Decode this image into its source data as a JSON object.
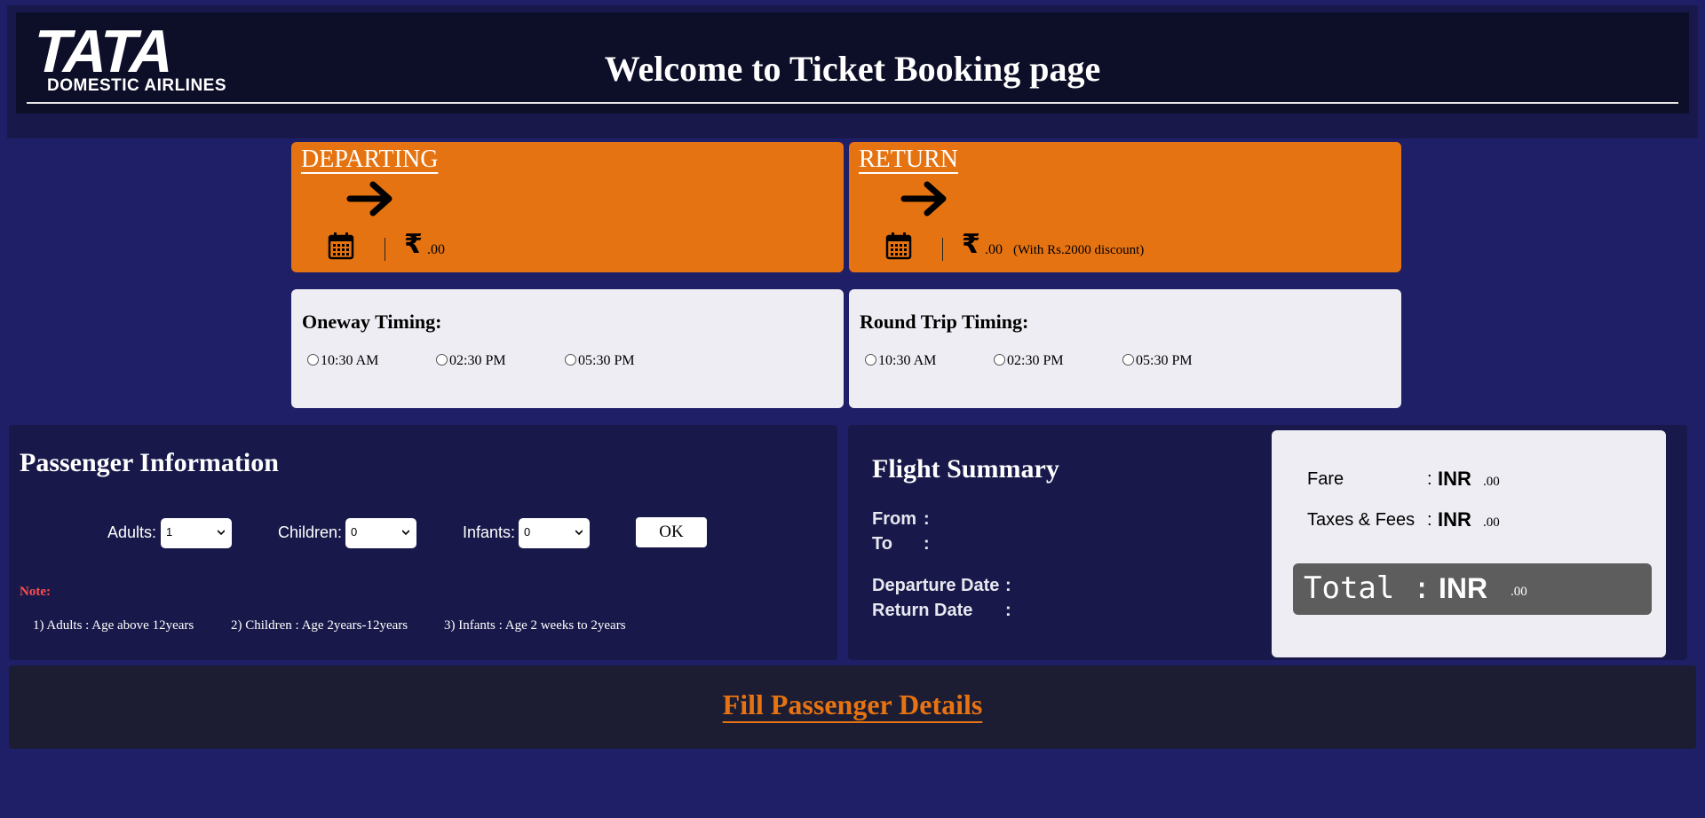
{
  "header": {
    "logo_text": "TATA",
    "logo_subtext": "DOMESTIC AIRLINES",
    "title": "Welcome to Ticket Booking page"
  },
  "departing": {
    "title": "DEPARTING",
    "currency_symbol": "₹",
    "amount": ".00"
  },
  "return_card": {
    "title": "RETURN",
    "currency_symbol": "₹",
    "amount": ".00",
    "discount_note": "(With Rs.2000 discount)"
  },
  "oneway": {
    "title": "Oneway Timing:",
    "options": [
      "10:30 AM",
      "02:30 PM",
      "05:30 PM"
    ]
  },
  "roundtrip": {
    "title": "Round Trip Timing:",
    "options": [
      "10:30 AM",
      "02:30 PM",
      "05:30 PM"
    ]
  },
  "passenger": {
    "title": "Passenger Information",
    "adults_label": "Adults:",
    "adults_value": "1",
    "children_label": "Children:",
    "children_value": "0",
    "infants_label": "Infants:",
    "infants_value": "0",
    "ok_label": "OK",
    "note_label": "Note:",
    "notes": [
      "1)  Adults : Age above 12years",
      "2)  Children : Age 2years-12years",
      "3)  Infants : Age 2 weeks to 2years"
    ]
  },
  "summary": {
    "title": "Flight Summary",
    "from_label": "From",
    "to_label": "To",
    "departure_label": "Departure Date",
    "return_label": "Return Date",
    "colon": ":"
  },
  "fare": {
    "fare_label": "Fare",
    "taxes_label": "Taxes & Fees",
    "colon": ":",
    "currency": "INR",
    "fare_amount": ".00",
    "taxes_amount": ".00",
    "total_label": "Total  :",
    "total_currency": "INR",
    "total_amount": ".00"
  },
  "cta": {
    "label": "Fill Passenger Details"
  },
  "colors": {
    "page_bg": "#1e1f66",
    "accent_orange": "#e67311",
    "panel_dark": "#18194a",
    "panel_light": "#eeedf3"
  }
}
